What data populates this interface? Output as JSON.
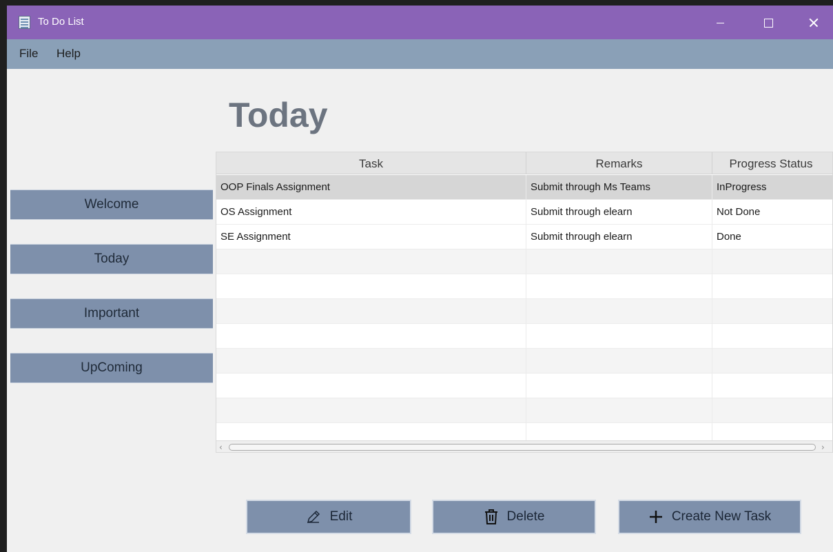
{
  "window": {
    "title": "To Do List"
  },
  "menubar": {
    "items": [
      {
        "label": "File"
      },
      {
        "label": "Help"
      }
    ]
  },
  "page": {
    "title": "Today"
  },
  "sidebar": {
    "items": [
      {
        "label": "Welcome"
      },
      {
        "label": "Today"
      },
      {
        "label": "Important"
      },
      {
        "label": "UpComing"
      }
    ]
  },
  "table": {
    "columns": [
      "Task",
      "Remarks",
      "Progress Status"
    ],
    "rows": [
      {
        "task": "OOP Finals Assignment",
        "remarks": "Submit through Ms Teams",
        "status": "InProgress"
      },
      {
        "task": "OS Assignment",
        "remarks": "Submit through elearn",
        "status": "Not Done"
      },
      {
        "task": "SE Assignment",
        "remarks": "Submit through elearn",
        "status": "Done"
      },
      {
        "task": "",
        "remarks": "",
        "status": ""
      },
      {
        "task": "",
        "remarks": "",
        "status": ""
      },
      {
        "task": "",
        "remarks": "",
        "status": ""
      },
      {
        "task": "",
        "remarks": "",
        "status": ""
      },
      {
        "task": "",
        "remarks": "",
        "status": ""
      },
      {
        "task": "",
        "remarks": "",
        "status": ""
      },
      {
        "task": "",
        "remarks": "",
        "status": ""
      },
      {
        "task": "",
        "remarks": "",
        "status": ""
      }
    ],
    "selected_row": 0
  },
  "actions": {
    "edit_label": "Edit",
    "edit_icon": "pencil-icon",
    "delete_label": "Delete",
    "delete_icon": "trash-icon",
    "create_label": "Create New Task",
    "create_icon": "plus-icon"
  },
  "colors": {
    "titlebar": "#8a63b7",
    "menubar": "#8aa0b7",
    "button": "#7e90ab",
    "title_text": "#6c7480"
  }
}
